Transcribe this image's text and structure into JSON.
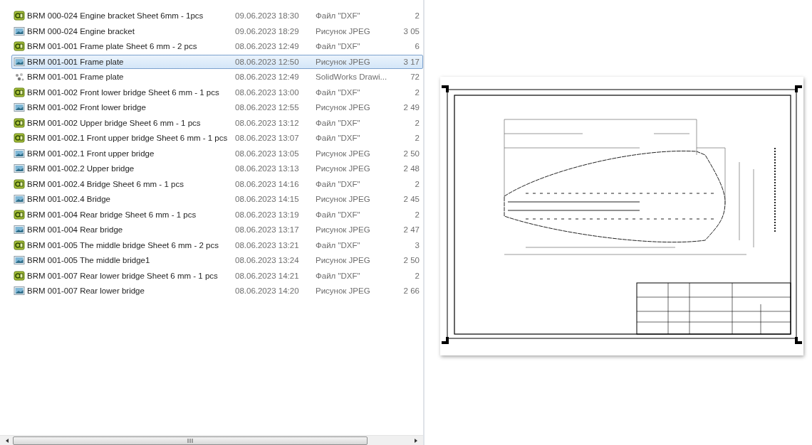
{
  "files": [
    {
      "kind": "dxf",
      "name": "BRM 000-024 Engine bracket Sheet 6mm - 1pcs",
      "date": "09.06.2023 18:30",
      "type": "Файл \"DXF\"",
      "size": "2",
      "selected": false
    },
    {
      "kind": "jpeg",
      "name": "BRM 000-024 Engine bracket",
      "date": "09.06.2023 18:29",
      "type": "Рисунок JPEG",
      "size": "3 05",
      "selected": false
    },
    {
      "kind": "dxf",
      "name": "BRM 001-001 Frame plate Sheet 6 mm - 2 pcs",
      "date": "08.06.2023 12:49",
      "type": "Файл \"DXF\"",
      "size": "6",
      "selected": false
    },
    {
      "kind": "jpeg",
      "name": "BRM 001-001 Frame plate",
      "date": "08.06.2023 12:50",
      "type": "Рисунок JPEG",
      "size": "3 17",
      "selected": true
    },
    {
      "kind": "drawing",
      "name": "BRM 001-001 Frame plate",
      "date": "08.06.2023 12:49",
      "type": "SolidWorks Drawi...",
      "size": "72",
      "selected": false
    },
    {
      "kind": "dxf",
      "name": "BRM 001-002 Front lower bridge Sheet 6 mm - 1 pcs",
      "date": "08.06.2023 13:00",
      "type": "Файл \"DXF\"",
      "size": "2",
      "selected": false
    },
    {
      "kind": "jpeg",
      "name": "BRM 001-002 Front lower bridge",
      "date": "08.06.2023 12:55",
      "type": "Рисунок JPEG",
      "size": "2 49",
      "selected": false
    },
    {
      "kind": "dxf",
      "name": "BRM 001-002 Upper bridge Sheet 6 mm - 1 pcs",
      "date": "08.06.2023 13:12",
      "type": "Файл \"DXF\"",
      "size": "2",
      "selected": false
    },
    {
      "kind": "dxf",
      "name": "BRM 001-002.1 Front upper bridge Sheet 6 mm - 1 pcs",
      "date": "08.06.2023 13:07",
      "type": "Файл \"DXF\"",
      "size": "2",
      "selected": false
    },
    {
      "kind": "jpeg",
      "name": "BRM 001-002.1 Front upper bridge",
      "date": "08.06.2023 13:05",
      "type": "Рисунок JPEG",
      "size": "2 50",
      "selected": false
    },
    {
      "kind": "jpeg",
      "name": "BRM 001-002.2 Upper bridge",
      "date": "08.06.2023 13:13",
      "type": "Рисунок JPEG",
      "size": "2 48",
      "selected": false
    },
    {
      "kind": "dxf",
      "name": "BRM 001-002.4 Bridge Sheet 6 mm - 1 pcs",
      "date": "08.06.2023 14:16",
      "type": "Файл \"DXF\"",
      "size": "2",
      "selected": false
    },
    {
      "kind": "jpeg",
      "name": "BRM 001-002.4 Bridge",
      "date": "08.06.2023 14:15",
      "type": "Рисунок JPEG",
      "size": "2 45",
      "selected": false
    },
    {
      "kind": "dxf",
      "name": "BRM 001-004 Rear bridge Sheet 6 mm - 1 pcs",
      "date": "08.06.2023 13:19",
      "type": "Файл \"DXF\"",
      "size": "2",
      "selected": false
    },
    {
      "kind": "jpeg",
      "name": "BRM 001-004 Rear bridge",
      "date": "08.06.2023 13:17",
      "type": "Рисунок JPEG",
      "size": "2 47",
      "selected": false
    },
    {
      "kind": "dxf",
      "name": "BRM 001-005 The middle bridge Sheet 6 mm - 2 pcs",
      "date": "08.06.2023 13:21",
      "type": "Файл \"DXF\"",
      "size": "3",
      "selected": false
    },
    {
      "kind": "jpeg",
      "name": "BRM 001-005 The middle bridge1",
      "date": "08.06.2023 13:24",
      "type": "Рисунок JPEG",
      "size": "2 50",
      "selected": false
    },
    {
      "kind": "dxf",
      "name": "BRM 001-007 Rear lower bridge Sheet 6 mm - 1 pcs",
      "date": "08.06.2023 14:21",
      "type": "Файл \"DXF\"",
      "size": "2",
      "selected": false
    },
    {
      "kind": "jpeg",
      "name": "BRM 001-007 Rear lower bridge",
      "date": "08.06.2023 14:20",
      "type": "Рисунок JPEG",
      "size": "2 66",
      "selected": false
    }
  ]
}
